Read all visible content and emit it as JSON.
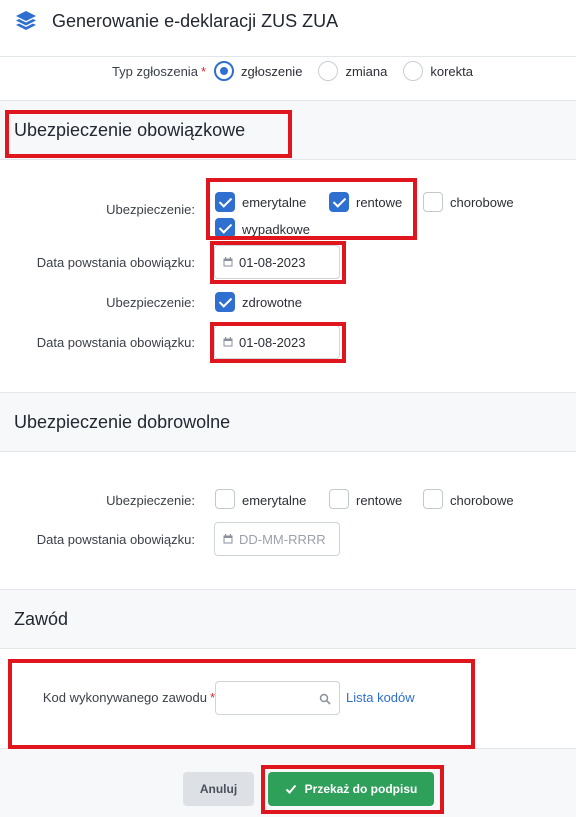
{
  "header": {
    "title": "Generowanie e-deklaracji ZUS ZUA",
    "icon": "layers-icon"
  },
  "type": {
    "label": "Typ zgłoszenia",
    "required_mark": "*",
    "options": [
      {
        "label": "zgłoszenie",
        "checked": true
      },
      {
        "label": "zmiana",
        "checked": false
      },
      {
        "label": "korekta",
        "checked": false
      }
    ]
  },
  "mandatory": {
    "title": "Ubezpieczenie obowiązkowe",
    "insurance_label": "Ubezpieczenie:",
    "insurance_options": [
      {
        "label": "emerytalne",
        "checked": true
      },
      {
        "label": "rentowe",
        "checked": true
      },
      {
        "label": "chorobowe",
        "checked": false
      },
      {
        "label": "wypadkowe",
        "checked": true
      }
    ],
    "date_label": "Data powstania obowiązku:",
    "date_value": "01-08-2023",
    "health_label": "Ubezpieczenie:",
    "health_option": {
      "label": "zdrowotne",
      "checked": true
    },
    "health_date_label": "Data powstania obowiązku:",
    "health_date_value": "01-08-2023"
  },
  "voluntary": {
    "title": "Ubezpieczenie dobrowolne",
    "insurance_label": "Ubezpieczenie:",
    "insurance_options": [
      {
        "label": "emerytalne",
        "checked": false
      },
      {
        "label": "rentowe",
        "checked": false
      },
      {
        "label": "chorobowe",
        "checked": false
      }
    ],
    "date_label": "Data powstania obowiązku:",
    "date_placeholder": "DD-MM-RRRR"
  },
  "occupation": {
    "title": "Zawód",
    "code_label": "Kod wykonywanego zawodu",
    "required_mark": "*",
    "code_value": "",
    "list_link": "Lista kodów"
  },
  "footer": {
    "cancel_label": "Anuluj",
    "submit_label": "Przekaż do podpisu"
  },
  "colors": {
    "accent": "#2f6fd0",
    "submit": "#2ea05a",
    "highlight": "#e0161e"
  }
}
